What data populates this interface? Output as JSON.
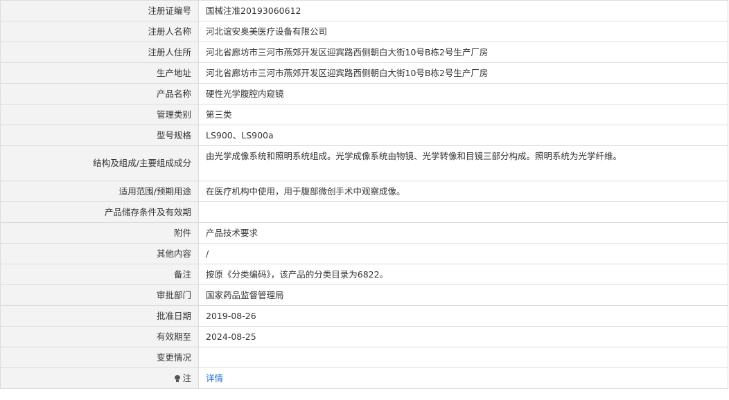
{
  "rows": [
    {
      "label": "注册证编号",
      "value": "国械注准20193060612"
    },
    {
      "label": "注册人名称",
      "value": "河北谊安奥美医疗设备有限公司"
    },
    {
      "label": "注册人住所",
      "value": "河北省廊坊市三河市燕郊开发区迎宾路西侧朝白大街10号B栋2号生产厂房"
    },
    {
      "label": "生产地址",
      "value": "河北省廊坊市三河市燕郊开发区迎宾路西侧朝白大街10号B栋2号生产厂房"
    },
    {
      "label": "产品名称",
      "value": "硬性光学腹腔内窥镜"
    },
    {
      "label": "管理类别",
      "value": "第三类"
    },
    {
      "label": "型号规格",
      "value": "LS900、LS900a"
    },
    {
      "label": "结构及组成/主要组成成分",
      "value": "由光学成像系统和照明系统组成。光学成像系统由物镜、光学转像和目镜三部分构成。照明系统为光学纤维。"
    },
    {
      "label": "适用范围/预期用途",
      "value": "在医疗机构中使用，用于腹部微创手术中观察成像。"
    },
    {
      "label": "产品储存条件及有效期",
      "value": ""
    },
    {
      "label": "附件",
      "value": "产品技术要求"
    },
    {
      "label": "其他内容",
      "value": "/"
    },
    {
      "label": "备注",
      "value": "按原《分类编码》，该产品的分类目录为6822。"
    },
    {
      "label": "审批部门",
      "value": "国家药品监督管理局"
    },
    {
      "label": "批准日期",
      "value": "2019-08-26"
    },
    {
      "label": "有效期至",
      "value": "2024-08-25"
    },
    {
      "label": "变更情况",
      "value": ""
    }
  ],
  "note": {
    "label": "注",
    "icon": "lightbulb-icon",
    "link": "详情",
    "link_color": "#1f6fd1"
  },
  "colors": {
    "label_bg": "#f3f3f3",
    "border": "#dcdcdc",
    "text": "#333333"
  }
}
